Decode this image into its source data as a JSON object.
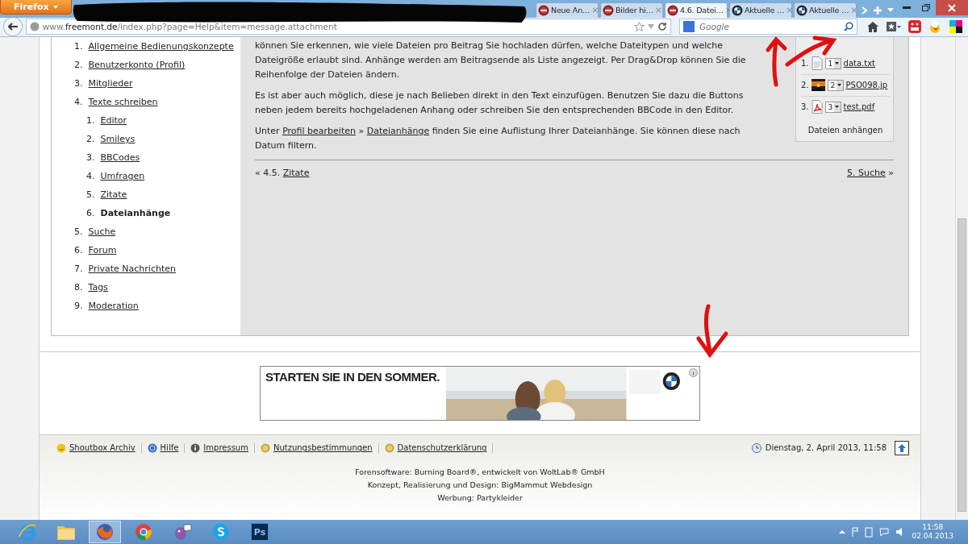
{
  "browser": {
    "menu_button": "Firefox",
    "tabs": [
      {
        "title": "Neue An…",
        "kind": "red",
        "selected": false
      },
      {
        "title": "Bilder hi…",
        "kind": "red",
        "selected": false
      },
      {
        "title": "4.6. Datei…",
        "kind": "red",
        "selected": true
      },
      {
        "title": "Aktuelle …",
        "kind": "roundel",
        "selected": false
      },
      {
        "title": "Aktuelle …",
        "kind": "roundel",
        "selected": false
      }
    ],
    "close_glyph": "×",
    "url": {
      "prefix": "www.",
      "domain": "freemont.de",
      "path": "/index.php?page=Help&item=message.attachment"
    },
    "search": {
      "placeholder": "Google"
    }
  },
  "sidebar": {
    "items": [
      {
        "number": "1.",
        "label": "Allgemeine Bedienungskonzepte",
        "selected": false
      },
      {
        "number": "2.",
        "label": "Benutzerkonto (Profil)",
        "selected": false
      },
      {
        "number": "3.",
        "label": "Mitglieder",
        "selected": false
      },
      {
        "number": "4.",
        "label": "Texte schreiben",
        "selected": false,
        "children": [
          {
            "number": "1.",
            "label": "Editor",
            "selected": false
          },
          {
            "number": "2.",
            "label": "Smileys",
            "selected": false
          },
          {
            "number": "3.",
            "label": "BBCodes",
            "selected": false
          },
          {
            "number": "4.",
            "label": "Umfragen",
            "selected": false
          },
          {
            "number": "5.",
            "label": "Zitate",
            "selected": false
          },
          {
            "number": "6.",
            "label": "Dateianhänge",
            "selected": true
          }
        ]
      },
      {
        "number": "5.",
        "label": "Suche",
        "selected": false
      },
      {
        "number": "6.",
        "label": "Forum",
        "selected": false
      },
      {
        "number": "7.",
        "label": "Private Nachrichten",
        "selected": false
      },
      {
        "number": "8.",
        "label": "Tags",
        "selected": false
      },
      {
        "number": "9.",
        "label": "Moderation",
        "selected": false
      }
    ]
  },
  "article": {
    "paragraphs": [
      [
        {
          "text": "können Sie erkennen, wie viele Dateien pro Beitrag Sie hochladen dürfen, welche Dateitypen und welche Dateigröße erlaubt sind. Anhänge werden am Beitragsende als Liste angezeigt. Per Drag&Drop können Sie die Reihenfolge der Dateien ändern."
        }
      ],
      [
        {
          "text": "Es ist aber auch möglich, diese je nach Belieben direkt in den Text einzufügen. Benutzen Sie dazu die Buttons neben jedem bereits hochgeladenen Anhang oder schreiben Sie den entsprechenden BBCode in den Editor."
        }
      ],
      [
        {
          "text": "Unter "
        },
        {
          "text": "Profil bearbeiten",
          "link": true
        },
        {
          "text": " » "
        },
        {
          "text": "Dateianhänge",
          "link": true
        },
        {
          "text": " finden Sie eine Auflistung Ihrer Dateianhänge. Sie können diese nach Datum filtern."
        }
      ]
    ],
    "attachments": {
      "files": [
        {
          "number": "1.",
          "kind": "text",
          "order": "1",
          "name": "data.txt"
        },
        {
          "number": "2.",
          "order": "2",
          "name": "PSO098.jp"
        },
        {
          "number": "3.",
          "kind": "pdf",
          "order": "3",
          "name": "test.pdf"
        }
      ],
      "button": "Dateien anhängen"
    },
    "prev": {
      "prefix": "« 4.5.",
      "link": "Zitate"
    },
    "next": {
      "link": "5. Suche",
      "suffix": "»"
    }
  },
  "ad": {
    "headline": "STARTEN SIE IN DEN SOMMER.",
    "kind": "picture"
  },
  "footer": {
    "links": [
      {
        "kind": "smiley",
        "label": "Shoutbox Archiv"
      },
      {
        "kind": "help",
        "label": "Hilfe"
      },
      {
        "kind": "info",
        "label": "Impressum"
      },
      {
        "kind": "coin",
        "label": "Nutzungsbestimmungen"
      },
      {
        "kind": "coin",
        "label": "Datenschutzerklärung"
      }
    ],
    "datetime": "Dienstag, 2. April 2013, 11:58",
    "credits": [
      "Forensoftware: Burning Board®, entwickelt von WoltLab® GmbH",
      "Konzept, Realisierung und Design: BigMammut Webdesign",
      "Werbung: Partykleider"
    ]
  },
  "taskbar": {
    "apps": [
      {
        "kind": "ie",
        "active": false
      },
      {
        "kind": "folder",
        "active": false
      },
      {
        "kind": "firefox",
        "active": true
      },
      {
        "kind": "chrome",
        "active": false
      },
      {
        "kind": "chat",
        "active": false
      },
      {
        "kind": "skype",
        "active": false
      },
      {
        "kind": "ps",
        "label": "Ps",
        "active": false
      }
    ],
    "time": "11:58",
    "date": "02.04.2013"
  }
}
